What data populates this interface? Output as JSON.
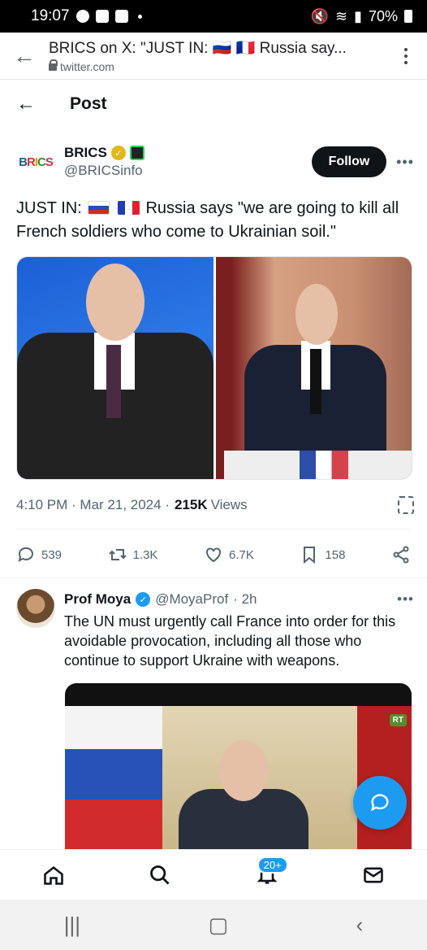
{
  "status_bar": {
    "time": "19:07",
    "battery": "70%"
  },
  "browser": {
    "page_title": "BRICS on X: \"JUST IN: 🇷🇺 🇫🇷 Russia say...",
    "url": "twitter.com"
  },
  "header": {
    "title": "Post"
  },
  "tweet": {
    "name": "BRICS",
    "handle": "@BRICSinfo",
    "avatar_text": [
      "B",
      "R",
      "I",
      "C",
      "S"
    ],
    "follow_label": "Follow",
    "text_prefix": "JUST IN:",
    "text_body": "Russia says \"we are going to kill all French soldiers who come to Ukrainian soil.\"",
    "time": "4:10 PM · Mar 21, 2024 ·",
    "views_count": "215K",
    "views_label": "Views",
    "replies": "539",
    "reposts": "1.3K",
    "likes": "6.7K",
    "bookmarks": "158"
  },
  "reply": {
    "name": "Prof Moya",
    "handle": "@MoyaProf",
    "age": "· 2h",
    "text": "The UN must urgently call France into order for this avoidable provocation, including all those who continue to support Ukraine with weapons.",
    "video_badge": "RT"
  },
  "bottom_nav": {
    "notifications_badge": "20+"
  },
  "colors": {
    "accent": "#1d9bf0",
    "text": "#0f1419",
    "muted": "#536471"
  }
}
